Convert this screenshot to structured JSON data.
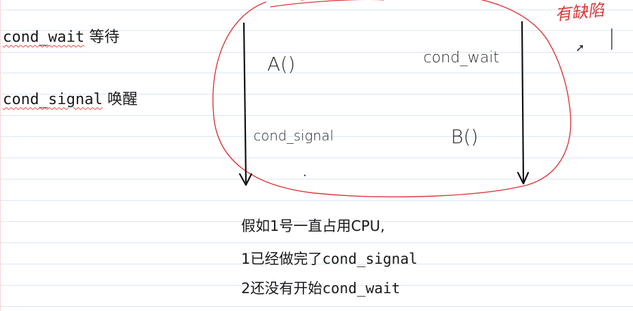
{
  "left_notes": [
    {
      "code": "cond_wait",
      "cn": "等待"
    },
    {
      "code": "cond_signal",
      "cn": "唤醒"
    }
  ],
  "diagram": {
    "thread1_a": "A()",
    "thread1_signal": "cond_signal",
    "thread2_wait": "cond_wait",
    "thread2_b": "B()",
    "flaw_label": "有缺陷",
    "ink_color": "#d9383a"
  },
  "explanation": {
    "line1_prefix": "假如1号一直占用CPU",
    "line1_suffix": ",",
    "line2_prefix": "1已经做完了",
    "line2_code": "cond_signal",
    "line3_prefix": "2还没有开始",
    "line3_code": "cond_wait"
  }
}
